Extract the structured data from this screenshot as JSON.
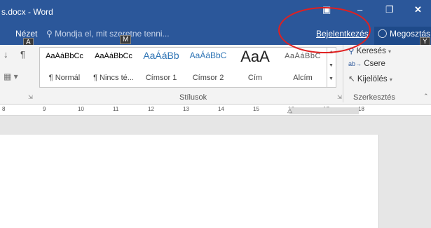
{
  "window": {
    "title": "s.docx - Word"
  },
  "title_icons": {
    "ribbon": "ribbon-display-icon",
    "min": "minimize-icon",
    "restore": "restore-icon",
    "close": "close-icon"
  },
  "tabs": {
    "view": "Nézet",
    "tell_me": "Mondja el, mit szeretne tenni...",
    "sign_in": "Bejelentkezés",
    "share": "Megosztás"
  },
  "keytips": {
    "view": "A",
    "tell_me": "M",
    "share": "Y"
  },
  "styles": [
    {
      "preview": "AaÁáBbCc",
      "name": "¶ Normál"
    },
    {
      "preview": "AaÁáBbCc",
      "name": "¶ Nincs té..."
    },
    {
      "preview": "AaÁáBb",
      "name": "Címsor 1"
    },
    {
      "preview": "AaÁáBbC",
      "name": "Címsor 2"
    },
    {
      "preview": "AaA",
      "name": "Cím"
    },
    {
      "preview": "AaÁáBbC",
      "name": "Alcím"
    }
  ],
  "groups": {
    "styles": "Stílusok",
    "editing": "Szerkesztés"
  },
  "editing": {
    "find": "Keresés",
    "replace": "Csere",
    "select": "Kijelölés"
  },
  "ruler": [
    "8",
    "9",
    "10",
    "11",
    "12",
    "13",
    "14",
    "15",
    "16",
    "17",
    "18"
  ],
  "colors": {
    "accent": "#2b579a",
    "annotation": "#e02020"
  }
}
